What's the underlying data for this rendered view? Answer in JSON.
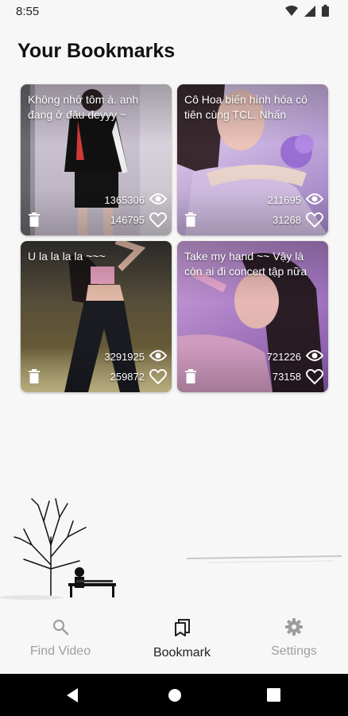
{
  "status_bar": {
    "time": "8:55"
  },
  "page": {
    "title": "Your Bookmarks"
  },
  "bookmarks": [
    {
      "caption": "Không nhớ tôm à. anh đang ở đâu đeyyy ~",
      "views": "1365306",
      "likes": "146795"
    },
    {
      "caption": "Cô Hoa biến hình hóa cô tiên cùng TCL.  Nhấn",
      "views": "211695",
      "likes": "31268"
    },
    {
      "caption": "U la la la la ~~~",
      "views": "3291925",
      "likes": "259872"
    },
    {
      "caption": "Take my hand ~~ Vậy là còn ai đi concert tập nữa",
      "views": "721226",
      "likes": "73158"
    }
  ],
  "nav": {
    "find_video": "Find Video",
    "bookmark": "Bookmark",
    "settings": "Settings"
  },
  "colors": {
    "background": "#f7f7f7",
    "active": "#222222",
    "inactive": "#9e9e9e"
  },
  "icons": [
    "wifi-icon",
    "signal-icon",
    "battery-icon",
    "eye-icon",
    "heart-icon",
    "trash-icon",
    "search-icon",
    "bookmark-icon",
    "gear-icon",
    "back-icon",
    "home-icon",
    "recents-icon"
  ]
}
